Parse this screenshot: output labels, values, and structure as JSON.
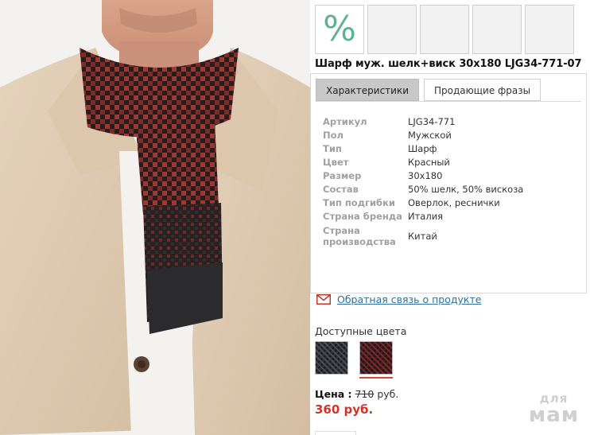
{
  "product": {
    "title": "Шарф муж. шелк+виск 30x180 LJG34-771-07",
    "badge_symbol": "%",
    "thumbnails": 4
  },
  "tabs": [
    {
      "label": "Характеристики",
      "active": true
    },
    {
      "label": "Продающие фразы",
      "active": false
    }
  ],
  "specs": [
    {
      "key": "Артикул",
      "value": "LJG34-771"
    },
    {
      "key": "Пол",
      "value": "Мужской"
    },
    {
      "key": "Тип",
      "value": "Шарф"
    },
    {
      "key": "Цвет",
      "value": "Красный"
    },
    {
      "key": "Размер",
      "value": "30x180"
    },
    {
      "key": "Состав",
      "value": "50% шелк, 50% вискоза"
    },
    {
      "key": "Тип подгибки",
      "value": "Оверлок, реснички"
    },
    {
      "key": "Страна бренда",
      "value": "Италия"
    },
    {
      "key": "Страна производства",
      "value": "Китай"
    }
  ],
  "feedback": {
    "label": "Обратная связь о продукте",
    "icon": "envelope-icon"
  },
  "colors": {
    "label": "Доступные цвета",
    "options": [
      {
        "name": "dark-grey-swatch",
        "selected": false
      },
      {
        "name": "red-swatch",
        "selected": true
      }
    ]
  },
  "price": {
    "label": "Цена :",
    "old_value": "710",
    "currency": "руб.",
    "new_price": "360 руб."
  },
  "watermark": {
    "line1": "для",
    "line2": "мам"
  },
  "colors_hex": {
    "badge": "#5fb393",
    "link": "#2f6f9f",
    "price_new": "#d0352a",
    "tab_active": "#c8c8c8"
  }
}
